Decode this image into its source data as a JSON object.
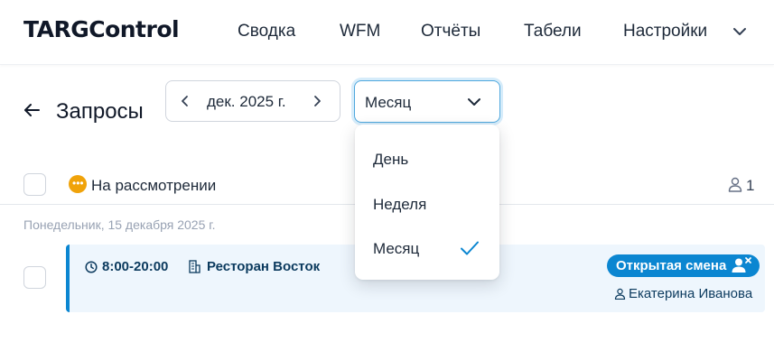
{
  "header": {
    "logo": "TARGControl",
    "nav": [
      {
        "label": "Сводка"
      },
      {
        "label": "WFM"
      },
      {
        "label": "Отчёты"
      },
      {
        "label": "Табели"
      },
      {
        "label": "Настройки",
        "icon": "chevron-down-icon"
      }
    ]
  },
  "toolbar": {
    "back_icon": "arrow-left-icon",
    "title": "Запросы",
    "period": {
      "label": "дек. 2025 г.",
      "prev_icon": "chevron-left-icon",
      "next_icon": "chevron-right-icon"
    },
    "view_select": {
      "value": "Месяц",
      "icon": "chevron-down-icon"
    }
  },
  "dropdown": {
    "options": [
      {
        "label": "День",
        "selected": false
      },
      {
        "label": "Неделя",
        "selected": false
      },
      {
        "label": "Месяц",
        "selected": true
      }
    ],
    "check_icon": "check-icon"
  },
  "group": {
    "status_label": "На рассмотрении",
    "status_color": "#f0a30a",
    "user_count": "1"
  },
  "date_heading": "Понедельник, 15 декабря 2025 г.",
  "requests": [
    {
      "time": "8:00-20:00",
      "location": "Ресторан Восток",
      "badge": "Открытая смена",
      "assignee": "Екатерина Иванова"
    }
  ],
  "colors": {
    "accent": "#0b86d1",
    "card_bg": "#eef6fd",
    "status_pending": "#f0a30a"
  }
}
